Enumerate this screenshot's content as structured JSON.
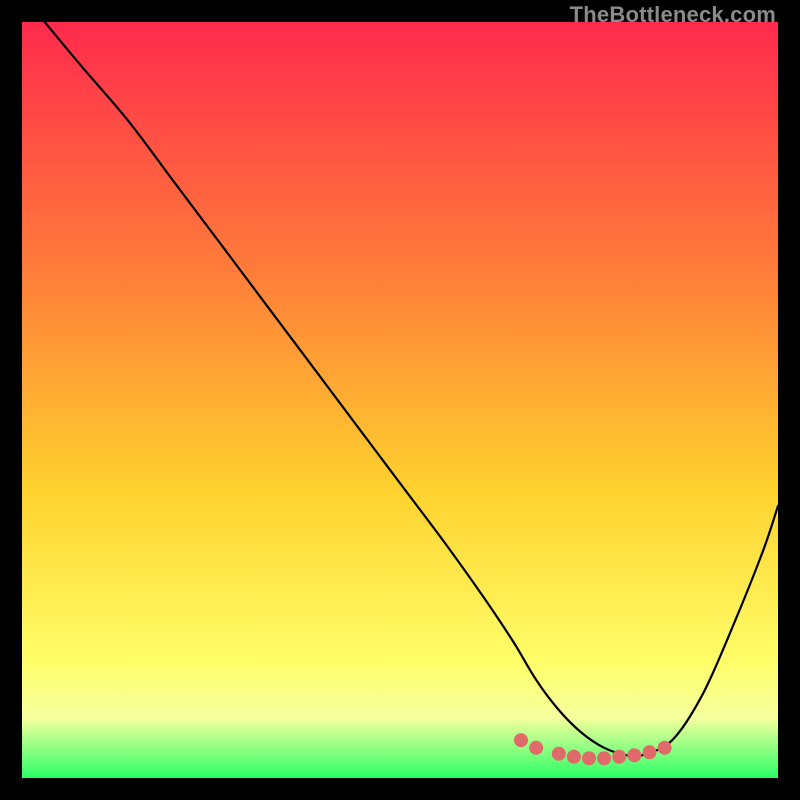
{
  "watermark": "TheBottleneck.com",
  "colors": {
    "top": "#ff2a4d",
    "mid1": "#ff7a3a",
    "mid2": "#ffd22e",
    "low": "#ffff6a",
    "lowband": "#f6ff9e",
    "bottom": "#2bff66",
    "curve": "#000000",
    "dots": "#e06a6a",
    "frame": "#000000"
  },
  "chart_data": {
    "type": "line",
    "title": "",
    "xlabel": "",
    "ylabel": "",
    "xlim": [
      0,
      100
    ],
    "ylim": [
      0,
      100
    ],
    "curve": {
      "x": [
        3,
        8,
        14,
        20,
        26,
        32,
        38,
        44,
        50,
        56,
        61,
        65,
        68,
        71,
        74,
        77,
        80,
        82,
        86,
        90,
        94,
        98,
        100
      ],
      "y": [
        100,
        94,
        87,
        79,
        71,
        63,
        55,
        47,
        39,
        31,
        24,
        18,
        13,
        9,
        6,
        4,
        3,
        3,
        5,
        11,
        20,
        30,
        36
      ]
    },
    "dots": {
      "x": [
        66,
        68,
        71,
        73,
        75,
        77,
        79,
        81,
        83,
        85
      ],
      "y": [
        5.0,
        4.0,
        3.2,
        2.8,
        2.6,
        2.6,
        2.8,
        3.0,
        3.4,
        4.0
      ]
    },
    "gradient_stops": [
      {
        "pct": 0,
        "color": "#ff2a4d"
      },
      {
        "pct": 32,
        "color": "#ff7a3a"
      },
      {
        "pct": 62,
        "color": "#ffd22e"
      },
      {
        "pct": 85,
        "color": "#ffff6a"
      },
      {
        "pct": 92,
        "color": "#f6ff9e"
      },
      {
        "pct": 100,
        "color": "#2bff66"
      }
    ]
  }
}
